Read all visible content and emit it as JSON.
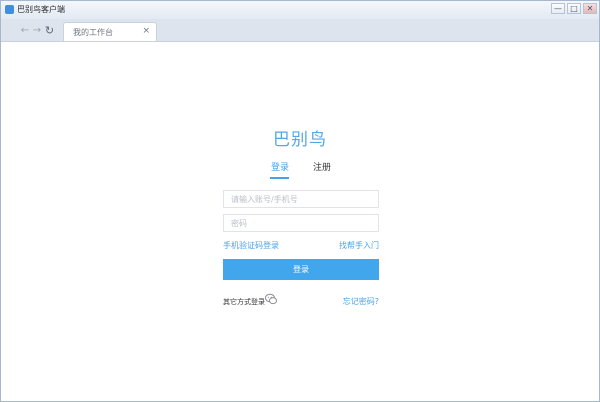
{
  "window": {
    "title": "巴别鸟客户端",
    "minimize_symbol": "—",
    "maximize_symbol": "□",
    "close_symbol": "✕"
  },
  "browser": {
    "back_symbol": "←",
    "forward_symbol": "→",
    "refresh_symbol": "↻",
    "tab": {
      "label": "我的工作台",
      "close_symbol": "×"
    }
  },
  "login": {
    "brand": "巴别鸟",
    "tabs": [
      {
        "label": "登录",
        "active": true
      },
      {
        "label": "注册",
        "active": false
      }
    ],
    "username_placeholder": "请输入账号/手机号",
    "password_placeholder": "密码",
    "phone_login_link": "手机验证码登录",
    "hire_link": "找帮手入门",
    "submit_label": "登录",
    "other_login_label": "其它方式登录",
    "forgot_link": "忘记密码?",
    "wechat_icon": "wechat-icon"
  },
  "colors": {
    "accent": "#4aa2e6",
    "button": "#42a6ec",
    "wechat": "#8a9099"
  }
}
